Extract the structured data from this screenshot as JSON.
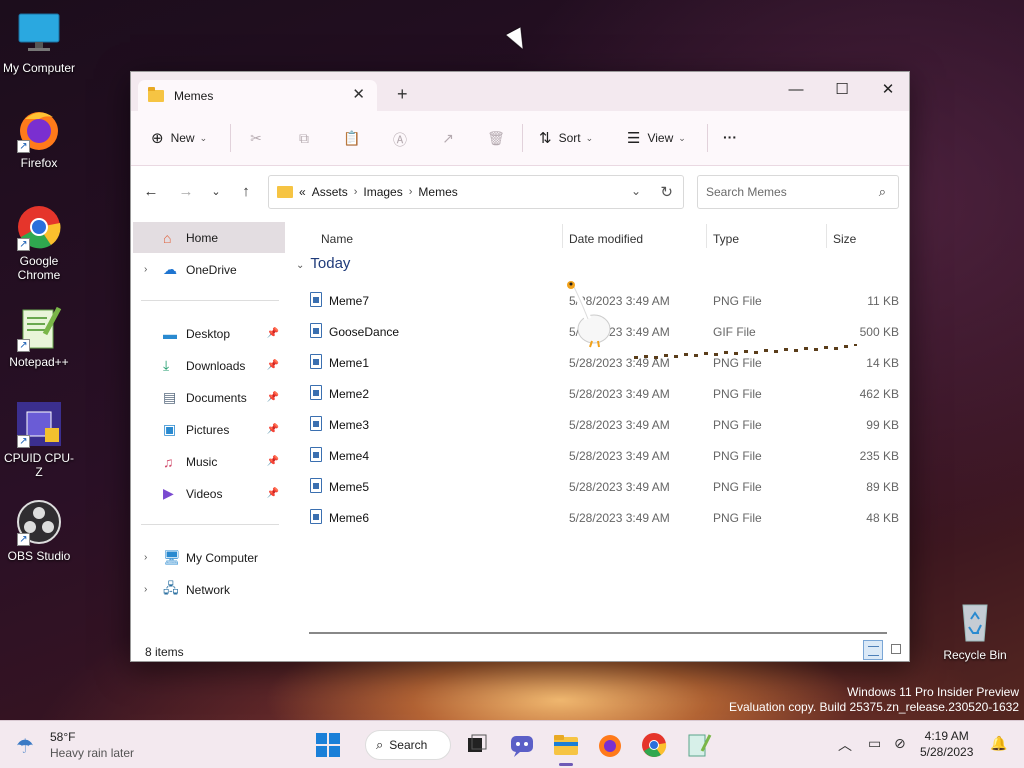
{
  "desktop": {
    "icons": [
      {
        "label": "My Computer"
      },
      {
        "label": "Firefox"
      },
      {
        "label": "Google Chrome"
      },
      {
        "label": "Notepad++"
      },
      {
        "label": "CPUID CPU-Z"
      },
      {
        "label": "OBS Studio"
      },
      {
        "label": "Recycle Bin"
      }
    ],
    "watermark": {
      "line1": "Windows 11 Pro Insider Preview",
      "line2": "Evaluation copy. Build 25375.zn_release.230520-1632"
    }
  },
  "window": {
    "tab_title": "Memes",
    "tab_close": "✕",
    "new_tab": "+",
    "controls": {
      "minimize": "—",
      "maximize": "☐",
      "close": "✕"
    },
    "toolbar": {
      "new_label": "New",
      "sort_label": "Sort",
      "view_label": "View",
      "more_label": "···"
    },
    "address": {
      "overflow": "«",
      "crumbs": [
        "Assets",
        "Images",
        "Memes"
      ]
    },
    "search_placeholder": "Search Memes",
    "nav": {
      "home": "Home",
      "onedrive": "OneDrive",
      "desktop": "Desktop",
      "downloads": "Downloads",
      "documents": "Documents",
      "pictures": "Pictures",
      "music": "Music",
      "videos": "Videos",
      "my_computer": "My Computer",
      "network": "Network"
    },
    "columns": {
      "name": "Name",
      "date": "Date modified",
      "type": "Type",
      "size": "Size"
    },
    "group_label": "Today",
    "files": [
      {
        "name": "Meme7",
        "date": "5/28/2023 3:49 AM",
        "type": "PNG File",
        "size": "11 KB"
      },
      {
        "name": "GooseDance",
        "date": "5/28/2023 3:49 AM",
        "type": "GIF File",
        "size": "500 KB"
      },
      {
        "name": "Meme1",
        "date": "5/28/2023 3:49 AM",
        "type": "PNG File",
        "size": "14 KB"
      },
      {
        "name": "Meme2",
        "date": "5/28/2023 3:49 AM",
        "type": "PNG File",
        "size": "462 KB"
      },
      {
        "name": "Meme3",
        "date": "5/28/2023 3:49 AM",
        "type": "PNG File",
        "size": "99 KB"
      },
      {
        "name": "Meme4",
        "date": "5/28/2023 3:49 AM",
        "type": "PNG File",
        "size": "235 KB"
      },
      {
        "name": "Meme5",
        "date": "5/28/2023 3:49 AM",
        "type": "PNG File",
        "size": "89 KB"
      },
      {
        "name": "Meme6",
        "date": "5/28/2023 3:49 AM",
        "type": "PNG File",
        "size": "48 KB"
      }
    ],
    "status": "8 items"
  },
  "taskbar": {
    "weather_temp": "58°F",
    "weather_desc": "Heavy rain later",
    "search_label": "Search",
    "time": "4:19 AM",
    "date": "5/28/2023"
  },
  "colors": {
    "titlebar": "#f3e9ef",
    "accent": "#1f3b7a",
    "folder": "#f6c443",
    "selection": "#e3dde1"
  }
}
